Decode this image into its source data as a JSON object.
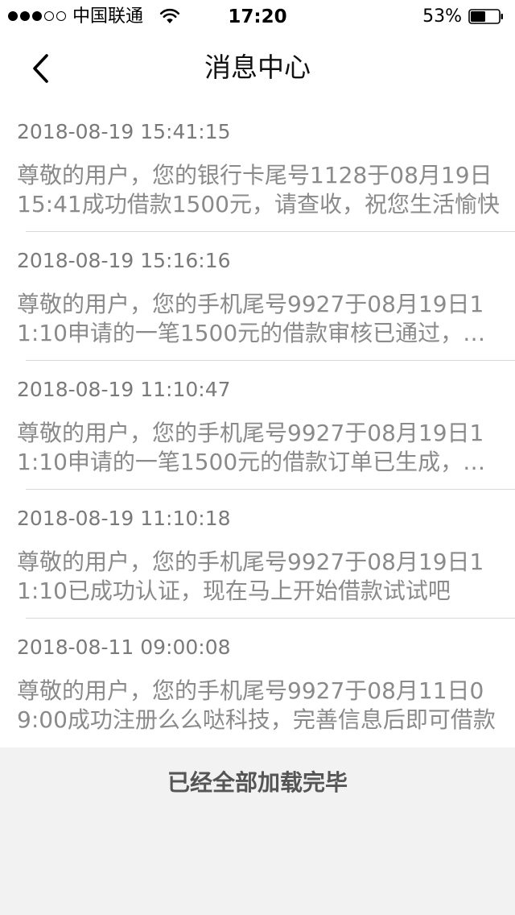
{
  "status_bar": {
    "signal_bars": 3,
    "signal_total": 5,
    "carrier": "中国联通",
    "time": "17:20",
    "battery_percent": "53%",
    "battery_level": 0.53,
    "icons": [
      "wifi-icon",
      "battery-icon"
    ]
  },
  "nav": {
    "title": "消息中心",
    "back_icon": "chevron-left-icon"
  },
  "messages": [
    {
      "time": "2018-08-19 15:41:15",
      "text": "尊敬的用户，您的银行卡尾号1128于08月19日15:41成功借款1500元，请查收，祝您生活愉快"
    },
    {
      "time": "2018-08-19 15:16:16",
      "text": "尊敬的用户，您的手机尾号9927于08月19日11:10申请的一笔1500元的借款审核已通过，请耐心等待"
    },
    {
      "time": "2018-08-19 11:10:47",
      "text": "尊敬的用户，您的手机尾号9927于08月19日11:10申请的一笔1500元的借款订单已生成，请耐心等待审核"
    },
    {
      "time": "2018-08-19 11:10:18",
      "text": "尊敬的用户，您的手机尾号9927于08月19日11:10已成功认证，现在马上开始借款试试吧"
    },
    {
      "time": "2018-08-11 09:00:08",
      "text": "尊敬的用户，您的手机尾号9927于08月11日09:00成功注册么么哒科技，完善信息后即可借款"
    }
  ],
  "footer": {
    "text": "已经全部加载完毕"
  },
  "colors": {
    "time_text": "#7a7a7a",
    "content_text": "#8a8a8a",
    "background": "#f2f2f2",
    "divider": "#d8d8d8"
  }
}
